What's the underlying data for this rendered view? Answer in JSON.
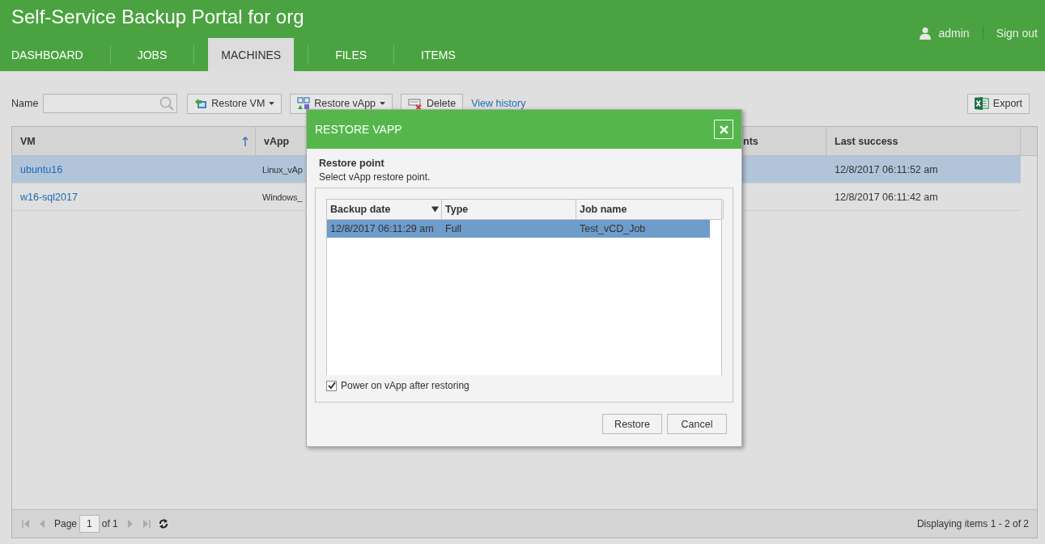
{
  "header": {
    "title": "Self-Service Backup Portal for org",
    "user": "admin",
    "sign_out": "Sign out",
    "tabs": [
      {
        "label": "DASHBOARD",
        "selected": false
      },
      {
        "label": "JOBS",
        "selected": false
      },
      {
        "label": "MACHINES",
        "selected": true
      },
      {
        "label": "FILES",
        "selected": false
      },
      {
        "label": "ITEMS",
        "selected": false
      }
    ]
  },
  "toolbar": {
    "name_label": "Name",
    "buttons": [
      {
        "label": "Restore VM",
        "kind": "dropdown"
      },
      {
        "label": "Restore vApp",
        "kind": "dropdown"
      },
      {
        "label": "Delete",
        "kind": "plain"
      }
    ],
    "view_history": "View history",
    "export": "Export"
  },
  "grid": {
    "columns": [
      {
        "label": "VM",
        "sorted": true
      },
      {
        "label": "vApp",
        "sorted": false
      },
      {
        "label": "nts",
        "sorted": false
      },
      {
        "label": "Last success",
        "sorted": false
      }
    ],
    "rows": [
      {
        "selected": true,
        "cells": [
          "ubuntu16",
          "Linux_vAp",
          "",
          "12/8/2017 06:11:52 am"
        ]
      },
      {
        "selected": false,
        "cells": [
          "w16-sql2017",
          "Windows_",
          "",
          "12/8/2017 06:11:42 am"
        ]
      }
    ]
  },
  "pager": {
    "page_label": "Page",
    "page": "1",
    "of_label": "of 1",
    "status": "Displaying items 1 - 2 of 2"
  },
  "dialog": {
    "title": "RESTORE VAPP",
    "section_title": "Restore point",
    "section_hint": "Select vApp restore point.",
    "columns": [
      {
        "label": "Backup date",
        "sorted": true
      },
      {
        "label": "Type",
        "sorted": false
      },
      {
        "label": "Job name",
        "sorted": false
      }
    ],
    "rows": [
      {
        "selected": true,
        "cells": [
          "12/8/2017 06:11:29 am",
          "Full",
          "Test_vCD_Job"
        ]
      }
    ],
    "checkbox": {
      "label": "Power on vApp after restoring",
      "checked": true
    },
    "buttons": [
      "Restore",
      "Cancel"
    ]
  }
}
